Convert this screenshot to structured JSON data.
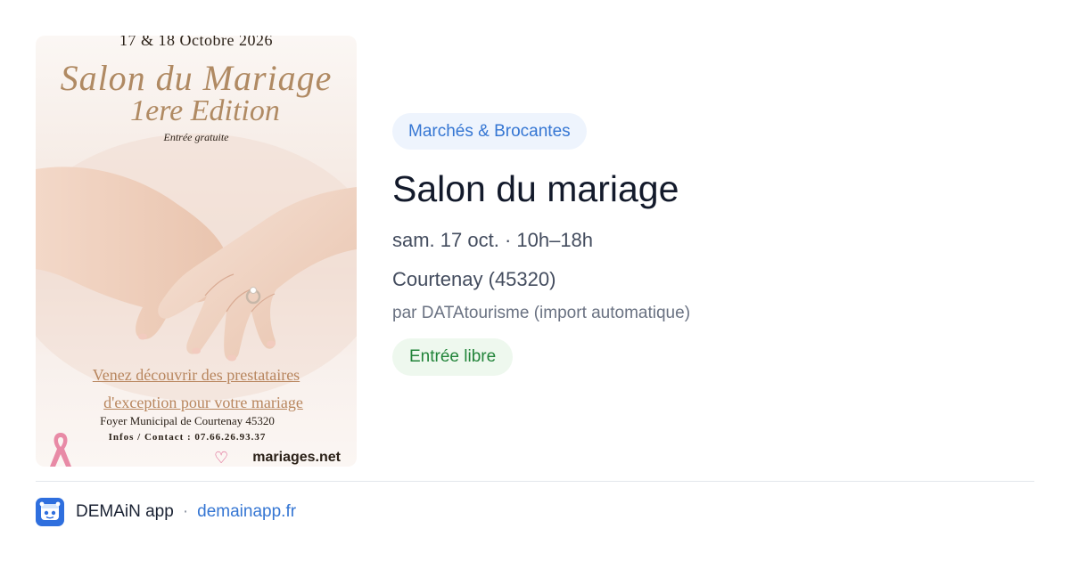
{
  "poster": {
    "dates": "17 & 18 Octobre 2026",
    "title_line1": "Salon du Mariage",
    "title_line2": "1ere Edition",
    "entry_note": "Entrée gratuite",
    "tagline_line1": "Venez découvrir des prestataires",
    "tagline_line2": "d'exception pour votre mariage",
    "venue": "Foyer Municipal de Courtenay 45320",
    "contact": "Infos / Contact : 07.66.26.93.37",
    "brand": "mariages.net"
  },
  "event": {
    "category": "Marchés & Brocantes",
    "title": "Salon du mariage",
    "when": "sam. 17 oct. · 10h–18h",
    "place": "Courtenay (45320)",
    "source": "par DATAtourisme (import automatique)",
    "price": "Entrée libre"
  },
  "footer": {
    "app_name": "DEMAiN app",
    "separator": "·",
    "domain": "demainapp.fr"
  },
  "colors": {
    "accent_blue": "#3576d3",
    "category_bg": "#eef4fd",
    "price_green": "#22843a",
    "price_bg": "#eef8ee",
    "app_icon_bg": "#2f6fde"
  },
  "icons": {
    "app_icon": "demain-app-icon",
    "heart": "heart-icon",
    "ribbon": "pink-ribbon-icon"
  }
}
